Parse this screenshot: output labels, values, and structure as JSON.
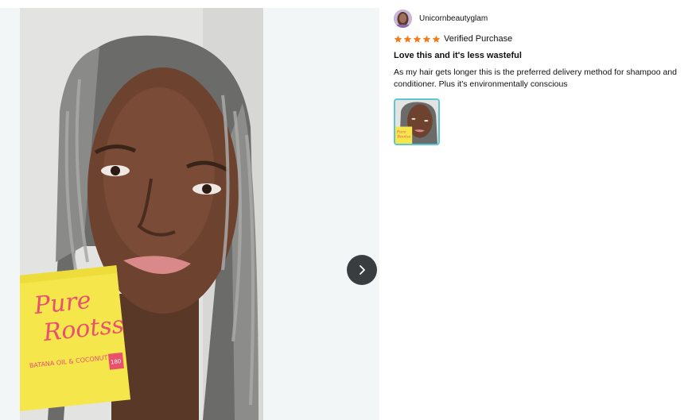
{
  "viewer": {
    "photo_alt": "Customer review photo",
    "product_box": {
      "brand_line1": "Pure",
      "brand_line2": "Rootss",
      "subtitle": "BATANA OIL & COCONUT",
      "badge": "180"
    },
    "next_icon": "chevron-right-icon"
  },
  "review": {
    "reviewer_name": "Unicornbeautyglam",
    "rating": 5,
    "rating_max": 5,
    "verified_label": "Verified Purchase",
    "title": "Love this and it's less wasteful",
    "body": "As my hair gets longer this is the preferred delivery method for shampoo and conditioner. Plus it's environmentally conscious"
  },
  "colors": {
    "star": "#f47d19",
    "thumb_border": "#5cc6d3",
    "next_button": "#3a3d3f",
    "viewer_bg": "#f3f6f7"
  }
}
